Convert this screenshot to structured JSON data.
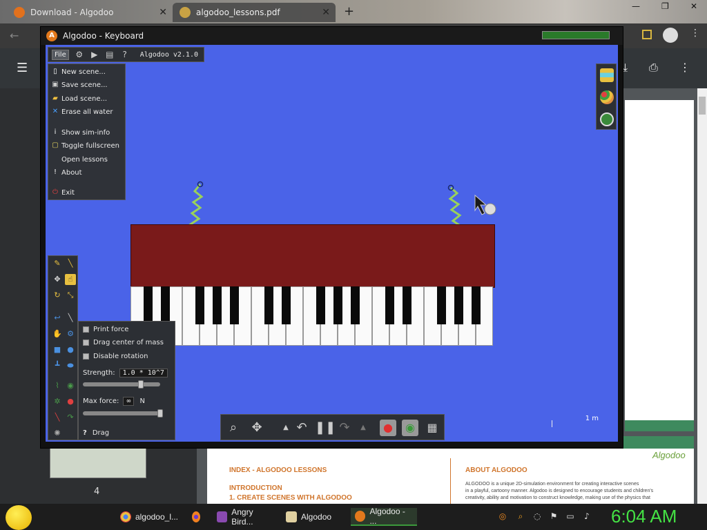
{
  "browser": {
    "tabs": [
      {
        "label": "Download - Algodoo"
      },
      {
        "label": "algodoo_lessons.pdf"
      }
    ],
    "newtab": "+",
    "winctl": [
      "—",
      "❐",
      "✕"
    ]
  },
  "pdf": {
    "page_number": "4",
    "heading_index": "INDEX - ALGODOO LESSONS",
    "heading_intro": "INTRODUCTION",
    "heading_create": "1. CREATE SCENES WITH ALGODOO",
    "heading_about": "ABOUT ALGODOO",
    "about_text_1": "ALGODOO is a unique 2D-simulation environment for creating interactive scenes",
    "about_text_2": "in a playful, cartoony manner. Algodoo is designed to encourage students and children's",
    "about_text_3": "creativity, ability and motivation to construct knowledge, making use of the physics that",
    "logo": "Algodoo"
  },
  "algodoo": {
    "window_title": "Algodoo - Keyboard",
    "app_icon_letter": "A",
    "version": "Algodoo v2.1.0",
    "menu_file": "File",
    "file_menu": [
      {
        "label": "New scene...",
        "icon": "new-file-icon"
      },
      {
        "label": "Save scene...",
        "icon": "save-icon"
      },
      {
        "label": "Load scene...",
        "icon": "folder-icon"
      },
      {
        "label": "Erase all water",
        "icon": "erase-icon"
      },
      {
        "label": "Show sim-info",
        "icon": "info-icon"
      },
      {
        "label": "Toggle fullscreen",
        "icon": "fullscreen-icon"
      },
      {
        "label": "Open lessons",
        "icon": ""
      },
      {
        "label": "About",
        "icon": "exclamation-icon"
      },
      {
        "label": "Exit",
        "icon": "exit-icon"
      }
    ],
    "options": {
      "print_force": "Print force",
      "drag_center": "Drag center of mass",
      "disable_rotation": "Disable rotation",
      "strength_label": "Strength:",
      "strength_value": "1.0 * 10^7",
      "strength_level": 0.75,
      "maxforce_label": "Max force:",
      "maxforce_value": "∞",
      "maxforce_unit": "N",
      "maxforce_level": 1.0,
      "drag_label": "Drag",
      "help_icon": "?"
    },
    "scale_label": "1 m",
    "colors": {
      "canvas_bg": "#4a63e8",
      "keyboard_body": "#7a1a1a",
      "spring": "#9ad25a"
    }
  },
  "taskbar": {
    "items": [
      {
        "label": "algodoo_l..."
      },
      {
        "label": "Angry Bird..."
      },
      {
        "label": "Algodoo"
      },
      {
        "label": "Algodoo - ..."
      }
    ],
    "clock": "6:04 AM"
  }
}
